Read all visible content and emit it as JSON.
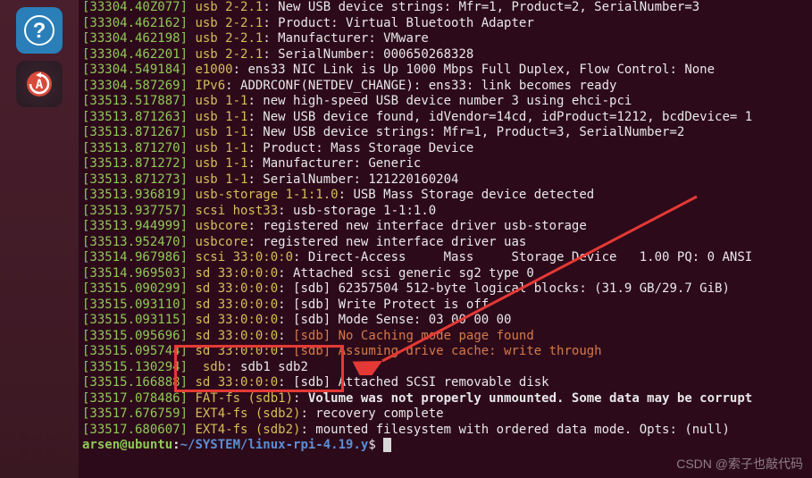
{
  "prompt": {
    "user": "arsen@ubuntu",
    "separator": ":",
    "path": "~/SYSTEM/linux-rpi-4.19.y",
    "symbol": "$"
  },
  "watermark": "CSDN @索子也敲代码",
  "lines": [
    {
      "ts": "[33304.40Z077]",
      "tag": " usb 2-2.1",
      "msg": ": New USB device strings: Mfr=1, Product=2, SerialNumber=3"
    },
    {
      "ts": "[33304.462162]",
      "tag": " usb 2-2.1",
      "msg": ": Product: Virtual Bluetooth Adapter"
    },
    {
      "ts": "[33304.462198]",
      "tag": " usb 2-2.1",
      "msg": ": Manufacturer: VMware"
    },
    {
      "ts": "[33304.462201]",
      "tag": " usb 2-2.1",
      "msg": ": SerialNumber: 000650268328"
    },
    {
      "ts": "[33304.549184]",
      "tag": " e1000",
      "msg": ": ens33 NIC Link is Up 1000 Mbps Full Duplex, Flow Control: None"
    },
    {
      "ts": "[33304.587269]",
      "tag": " IPv6",
      "msg": ": ADDRCONF(NETDEV_CHANGE): ens33: link becomes ready"
    },
    {
      "ts": "[33513.517887]",
      "tag": " usb 1-1",
      "msg": ": new high-speed USB device number 3 using ehci-pci"
    },
    {
      "ts": "[33513.871263]",
      "tag": " usb 1-1",
      "msg": ": New USB device found, idVendor=14cd, idProduct=1212, bcdDevice= 1"
    },
    {
      "ts": "[33513.871267]",
      "tag": " usb 1-1",
      "msg": ": New USB device strings: Mfr=1, Product=3, SerialNumber=2"
    },
    {
      "ts": "[33513.871270]",
      "tag": " usb 1-1",
      "msg": ": Product: Mass Storage Device"
    },
    {
      "ts": "[33513.871272]",
      "tag": " usb 1-1",
      "msg": ": Manufacturer: Generic"
    },
    {
      "ts": "[33513.871273]",
      "tag": " usb 1-1",
      "msg": ": SerialNumber: 121220160204"
    },
    {
      "ts": "[33513.936819]",
      "tag": " usb-storage 1-1:1.0",
      "msg": ": USB Mass Storage device detected"
    },
    {
      "ts": "[33513.937757]",
      "tag": " scsi host33",
      "msg": ": usb-storage 1-1:1.0"
    },
    {
      "ts": "[33513.944999]",
      "tag": " usbcore",
      "msg": ": registered new interface driver usb-storage"
    },
    {
      "ts": "[33513.952470]",
      "tag": " usbcore",
      "msg": ": registered new interface driver uas"
    },
    {
      "ts": "[33514.967986]",
      "tag": " scsi 33:0:0:0",
      "msg": ": Direct-Access     Mass     Storage Device   1.00 PQ: 0 ANSI"
    },
    {
      "ts": "[33514.969503]",
      "tag": " sd 33:0:0:0",
      "msg": ": Attached scsi generic sg2 type 0"
    },
    {
      "ts": "[33515.090299]",
      "tag": " sd 33:0:0:0",
      "msg": ": [sdb] 62357504 512-byte logical blocks: (31.9 GB/29.7 GiB)"
    },
    {
      "ts": "[33515.093110]",
      "tag": " sd 33:0:0:0",
      "msg": ": [sdb] Write Protect is off"
    },
    {
      "ts": "[33515.093115]",
      "tag": " sd 33:0:0:0",
      "msg": ": [sdb] Mode Sense: 03 00 00 00"
    },
    {
      "ts": "[33515.095696]",
      "tag": " sd 33:0:0:0",
      "msg": ": ",
      "warn": "[sdb] No Caching mode page found"
    },
    {
      "ts": "[33515.095744]",
      "tag": " sd 33:0:0:0",
      "msg": ": ",
      "warn": "[sdb] Assuming drive cache: write through"
    },
    {
      "ts": "[33515.130294]",
      "tag": "  sdb",
      "msg": ": sdb1 sdb2"
    },
    {
      "ts": "[33515.166888]",
      "tag": " sd 33:0:0:0",
      "msg": ": [sdb] Attached SCSI removable disk"
    },
    {
      "ts": "[33517.078486]",
      "tag": " FAT-fs (sdb1)",
      "msg": ": ",
      "bold": "Volume was not properly unmounted. Some data may be corrupt"
    },
    {
      "ts": "[33517.676759]",
      "tag": " EXT4-fs (sdb2)",
      "msg": ": recovery complete"
    },
    {
      "ts": "[33517.680607]",
      "tag": " EXT4-fs (sdb2)",
      "msg": ": mounted filesystem with ordered data mode. Opts: (null)"
    }
  ]
}
